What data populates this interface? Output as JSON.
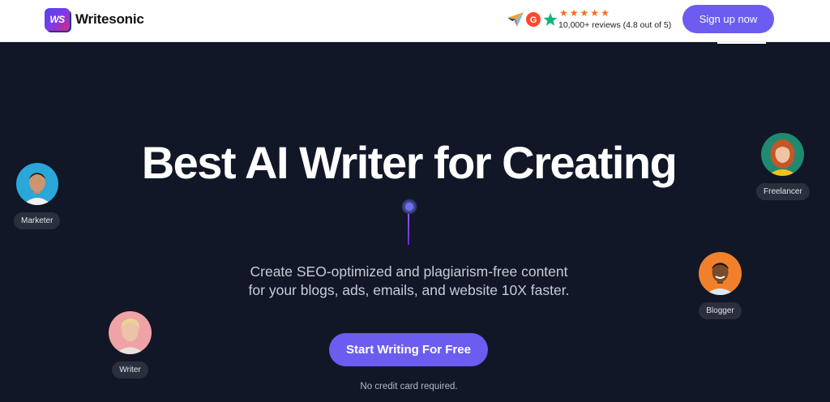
{
  "header": {
    "logo_mark": "WS",
    "logo_text": "Writesonic",
    "stars": [
      "★",
      "★",
      "★",
      "★",
      "★"
    ],
    "reviews": "10,000+ reviews (4.8 out of 5)",
    "signup_label": "Sign up now",
    "review_icons": [
      "capterra-icon",
      "g2-icon",
      "trustpilot-icon"
    ]
  },
  "hero": {
    "title": "Best AI Writer for Creating",
    "subtitle_line1": "Create SEO-optimized and plagiarism-free content",
    "subtitle_line2": "for your blogs, ads, emails, and website 10X faster.",
    "cta_label": "Start Writing For Free",
    "note": "No credit card required."
  },
  "personas": [
    {
      "label": "Marketer"
    },
    {
      "label": "Writer"
    },
    {
      "label": "Freelancer"
    },
    {
      "label": "Blogger"
    }
  ],
  "colors": {
    "background": "#111726",
    "accent": "#6c5cf0",
    "star": "#ff6b1a"
  }
}
